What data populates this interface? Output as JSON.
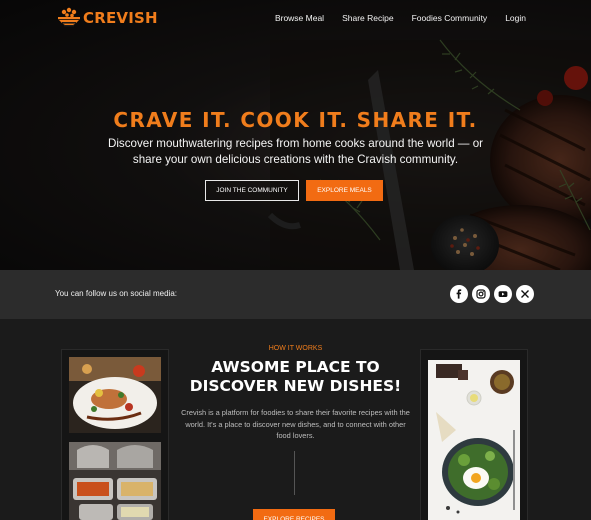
{
  "brand": {
    "name": "CREVISH",
    "accent": "#f07d1c",
    "button": "#f26b12"
  },
  "nav": {
    "links": [
      "Browse Meal",
      "Share Recipe",
      "Foodies Community",
      "Login"
    ]
  },
  "hero": {
    "title": "CRAVE IT. COOK IT. SHARE IT.",
    "subtitle": "Discover mouthwatering recipes from home cooks around the world — or share your own delicious creations with the Cravish community.",
    "buttons": {
      "join": "JOIN THE COMMUNITY",
      "explore": "EXPLORE MEALS"
    }
  },
  "social": {
    "text": "You can follow us on social media:",
    "icons": [
      "facebook-icon",
      "instagram-icon",
      "youtube-icon",
      "x-icon"
    ]
  },
  "how": {
    "tag": "HOW IT WORKS",
    "title": "AWSOME PLACE TO DISCOVER NEW DISHES!",
    "description": "Crevish is a platform for foodies to share their favorite recipes with the world. It's a place to discover new dishes, and to connect with other food lovers.",
    "button": "EXPLORE RECIPES"
  }
}
